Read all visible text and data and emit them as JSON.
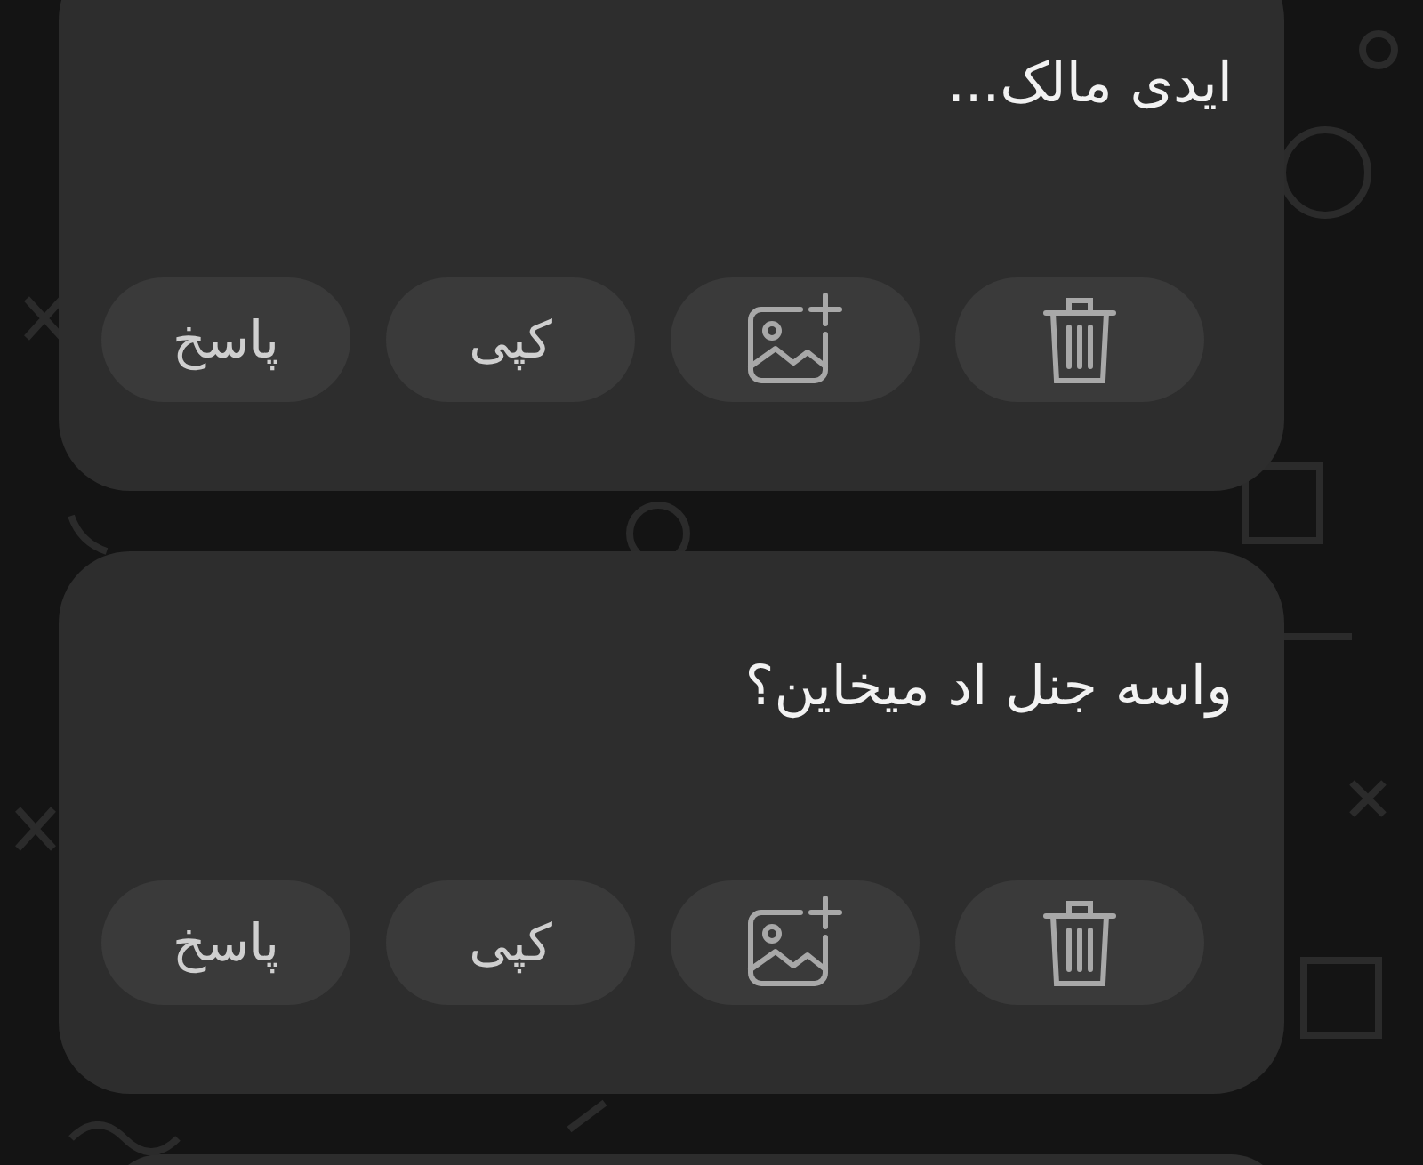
{
  "messages": [
    {
      "text": "ایدی مالک...",
      "actions": [
        {
          "kind": "delete"
        },
        {
          "kind": "image"
        },
        {
          "kind": "copy",
          "label": "کپی"
        },
        {
          "kind": "reply",
          "label": "پاسخ"
        }
      ]
    },
    {
      "text": "واسه جنل اد میخاین؟",
      "actions": [
        {
          "kind": "delete"
        },
        {
          "kind": "image"
        },
        {
          "kind": "copy",
          "label": "کپی"
        },
        {
          "kind": "reply",
          "label": "پاسخ"
        }
      ]
    }
  ]
}
